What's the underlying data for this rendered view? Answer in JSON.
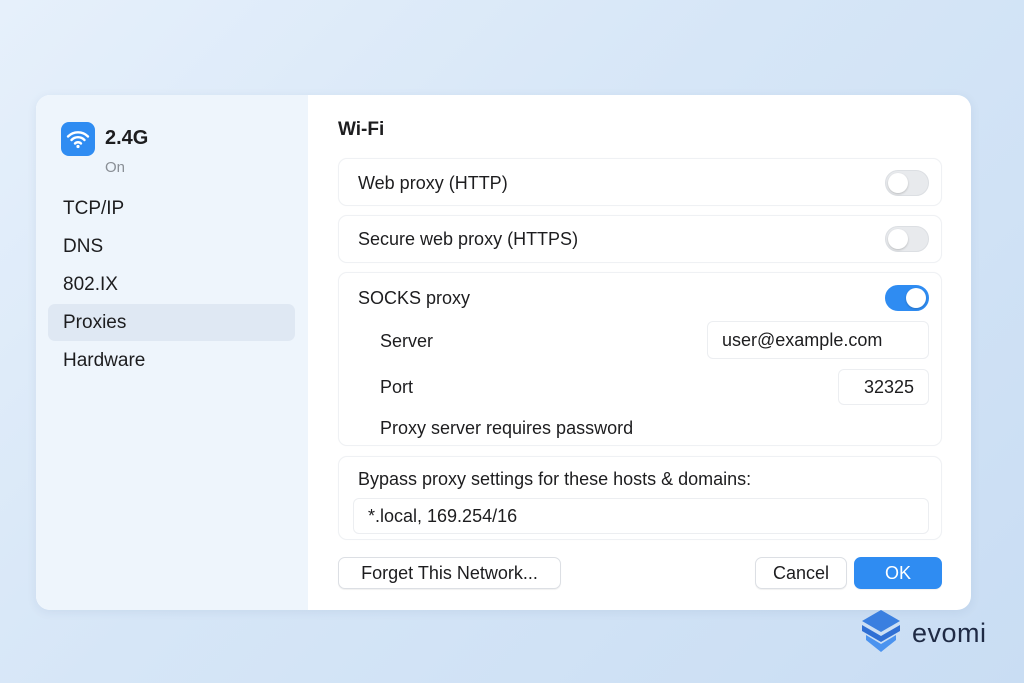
{
  "sidebar": {
    "network_name": "2.4G",
    "network_status": "On",
    "items": [
      {
        "label": "TCP/IP",
        "active": false
      },
      {
        "label": "DNS",
        "active": false
      },
      {
        "label": "802.IX",
        "active": false
      },
      {
        "label": "Proxies",
        "active": true
      },
      {
        "label": "Hardware",
        "active": false
      }
    ]
  },
  "main": {
    "title": "Wi-Fi",
    "web_proxy": {
      "label": "Web proxy (HTTP)",
      "enabled": false
    },
    "secure_proxy": {
      "label": "Secure web proxy (HTTPS)",
      "enabled": false
    },
    "socks_proxy": {
      "label": "SOCKS proxy",
      "enabled": true,
      "server_label": "Server",
      "server_value": "user@example.com",
      "port_label": "Port",
      "port_value": "32325",
      "password_label": "Proxy server requires password"
    },
    "bypass": {
      "label": "Bypass proxy settings for these hosts & domains:",
      "value": "*.local, 169.254/16"
    }
  },
  "buttons": {
    "forget": "Forget This Network...",
    "cancel": "Cancel",
    "ok": "OK"
  },
  "brand": {
    "name": "evomi"
  },
  "colors": {
    "accent": "#2f8cf2",
    "sidebar_bg": "#eef5fc",
    "selected_bg": "#dfe8f3"
  },
  "icons": {
    "network": "wifi-icon",
    "brand": "evomi-logo-icon"
  }
}
